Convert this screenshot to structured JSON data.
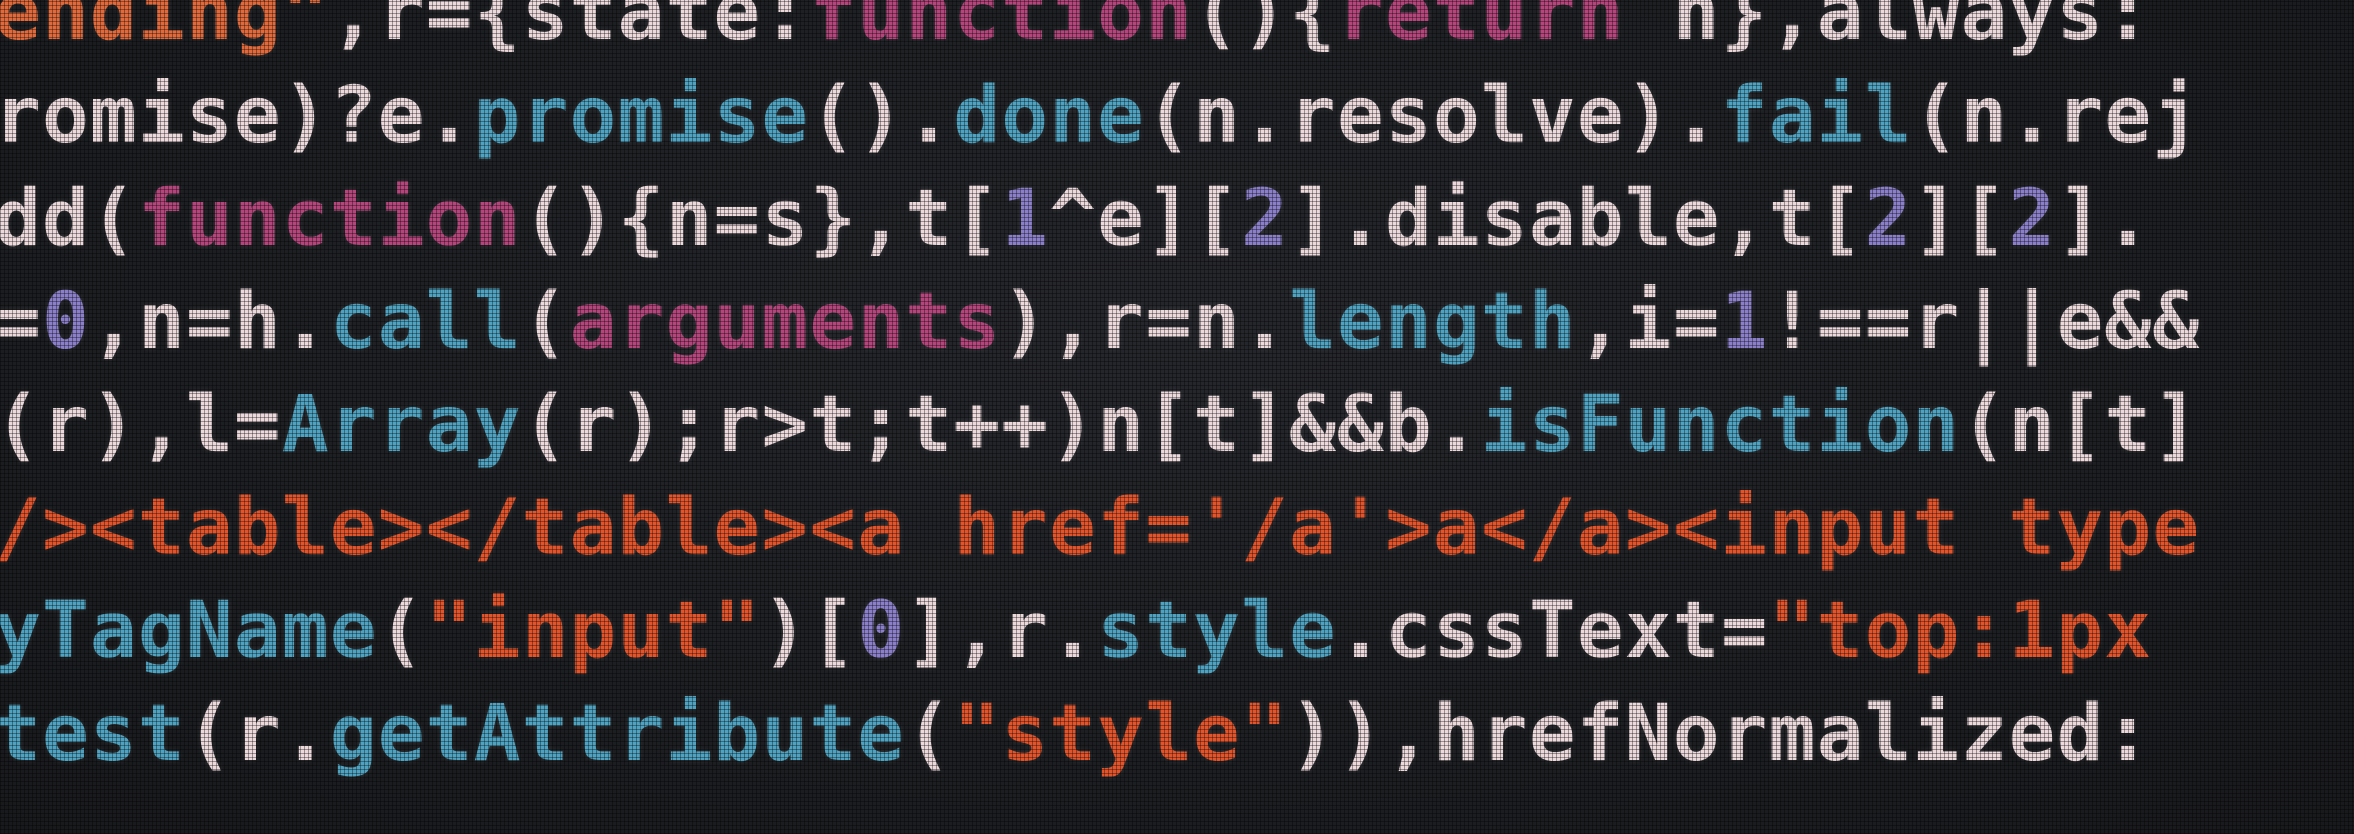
{
  "editor": {
    "lines": [
      [
        {
          "t": "ending\"",
          "c": "#e06a3b"
        },
        {
          "t": ",r={state:",
          "c": "#ecd9dc"
        },
        {
          "t": "function",
          "c": "#b4467c"
        },
        {
          "t": "(){",
          "c": "#ecd9dc"
        },
        {
          "t": "return",
          "c": "#b4467c"
        },
        {
          "t": " n},always:",
          "c": "#ecd9dc"
        }
      ],
      [
        {
          "t": "romise)?e.",
          "c": "#ecd9dc"
        },
        {
          "t": "promise",
          "c": "#4fa3c0"
        },
        {
          "t": "().",
          "c": "#ecd9dc"
        },
        {
          "t": "done",
          "c": "#4fa3c0"
        },
        {
          "t": "(n.resolve).",
          "c": "#ecd9dc"
        },
        {
          "t": "fail",
          "c": "#4fa3c0"
        },
        {
          "t": "(n.rej",
          "c": "#ecd9dc"
        }
      ],
      [
        {
          "t": "dd(",
          "c": "#ecd9dc"
        },
        {
          "t": "function",
          "c": "#b4467c"
        },
        {
          "t": "(){n=s},t[",
          "c": "#ecd9dc"
        },
        {
          "t": "1",
          "c": "#8a7fc8"
        },
        {
          "t": "^e][",
          "c": "#ecd9dc"
        },
        {
          "t": "2",
          "c": "#8a7fc8"
        },
        {
          "t": "].disable,t[",
          "c": "#ecd9dc"
        },
        {
          "t": "2",
          "c": "#8a7fc8"
        },
        {
          "t": "][",
          "c": "#ecd9dc"
        },
        {
          "t": "2",
          "c": "#8a7fc8"
        },
        {
          "t": "].",
          "c": "#ecd9dc"
        }
      ],
      [
        {
          "t": "=",
          "c": "#ecd9dc"
        },
        {
          "t": "0",
          "c": "#8a7fc8"
        },
        {
          "t": ",n=h.",
          "c": "#ecd9dc"
        },
        {
          "t": "call",
          "c": "#4fa3c0"
        },
        {
          "t": "(",
          "c": "#ecd9dc"
        },
        {
          "t": "arguments",
          "c": "#b4467c"
        },
        {
          "t": "),r=n.",
          "c": "#ecd9dc"
        },
        {
          "t": "length",
          "c": "#4fa3c0"
        },
        {
          "t": ",i=",
          "c": "#ecd9dc"
        },
        {
          "t": "1",
          "c": "#8a7fc8"
        },
        {
          "t": "!==r||e&&",
          "c": "#ecd9dc"
        }
      ],
      [
        {
          "t": "(r),l=",
          "c": "#ecd9dc"
        },
        {
          "t": "Array",
          "c": "#4fa3c0"
        },
        {
          "t": "(r);r>t;t++)n[t]&&b.",
          "c": "#ecd9dc"
        },
        {
          "t": "isFunction",
          "c": "#4fa3c0"
        },
        {
          "t": "(n[t]",
          "c": "#ecd9dc"
        }
      ],
      [
        {
          "t": "/><table></table><a href='/a'>a</a><input type",
          "c": "#e2542c"
        }
      ],
      [
        {
          "t": "yTagName",
          "c": "#4fa3c0"
        },
        {
          "t": "(",
          "c": "#ecd9dc"
        },
        {
          "t": "\"input\"",
          "c": "#e2542c"
        },
        {
          "t": ")[",
          "c": "#ecd9dc"
        },
        {
          "t": "0",
          "c": "#8a7fc8"
        },
        {
          "t": "],r.",
          "c": "#ecd9dc"
        },
        {
          "t": "style",
          "c": "#4fa3c0"
        },
        {
          "t": ".cssText=",
          "c": "#ecd9dc"
        },
        {
          "t": "\"top:1px",
          "c": "#e2542c"
        }
      ],
      [
        {
          "t": "test",
          "c": "#4fa3c0"
        },
        {
          "t": "(r.",
          "c": "#ecd9dc"
        },
        {
          "t": "getAttribute",
          "c": "#4fa3c0"
        },
        {
          "t": "(",
          "c": "#ecd9dc"
        },
        {
          "t": "\"style\"",
          "c": "#e2542c"
        },
        {
          "t": ")),hrefNormalized:",
          "c": "#ecd9dc"
        }
      ]
    ]
  }
}
